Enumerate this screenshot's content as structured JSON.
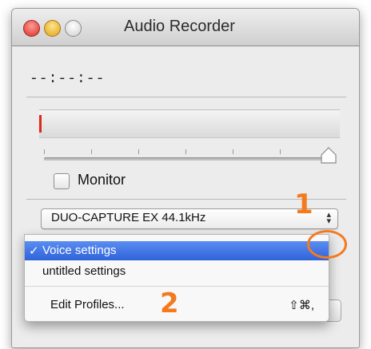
{
  "window": {
    "title": "Audio Recorder"
  },
  "recorder": {
    "time_display": "--:--:--",
    "level_percent": 0.8,
    "gain_fraction": 0.97,
    "monitor_label": "Monitor",
    "monitor_checked": false,
    "device_label": "DUO-CAPTURE EX 44.1kHz"
  },
  "profiles_menu": {
    "items": [
      {
        "label": "Voice settings",
        "checkmark": "✓",
        "selected": true
      },
      {
        "label": "untitled settings",
        "checkmark": "",
        "selected": false
      }
    ],
    "edit_label": "Edit Profiles...",
    "edit_shortcut": "⇧⌘,"
  },
  "annotations": {
    "step1": "1",
    "step2": "2",
    "color": "#f47a20"
  },
  "colors": {
    "menu_highlight": "#2f63d9",
    "level_meter": "#e0271c"
  }
}
